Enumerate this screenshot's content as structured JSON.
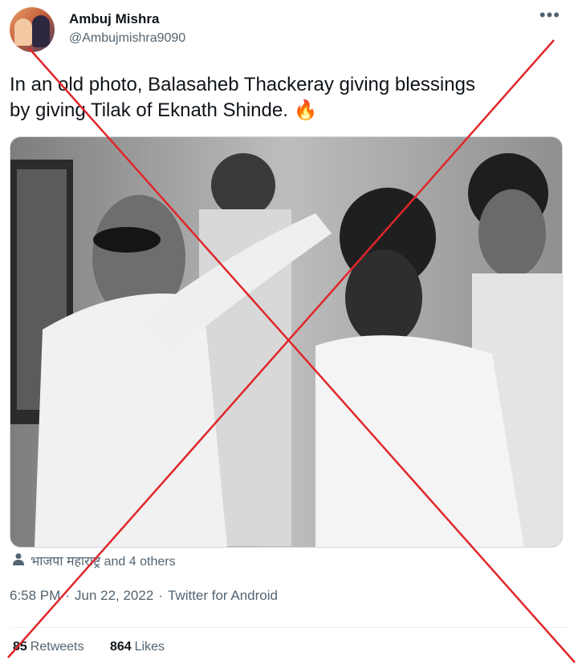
{
  "author": {
    "name": "Ambuj Mishra",
    "handle": "@Ambujmishra9090"
  },
  "more_icon": "more-dots-icon",
  "tweet": {
    "line1": "In an old photo, Balasaheb Thackeray giving blessings",
    "line2": "by giving Tilak of Eknath Shinde.",
    "emoji": "🔥"
  },
  "liked_by": {
    "icon": "person-icon",
    "text": "भाजपा महाराष्ट्र and 4 others"
  },
  "meta": {
    "time": "6:58 PM",
    "date": "Jun 22, 2022",
    "source": "Twitter for Android",
    "separator": "·"
  },
  "stats": {
    "retweets_count": "85",
    "retweets_label": "Retweets",
    "likes_count": "864",
    "likes_label": "Likes"
  },
  "colors": {
    "cross": "#e0262b",
    "secondary_text": "#536471",
    "divider": "#eff3f4"
  }
}
